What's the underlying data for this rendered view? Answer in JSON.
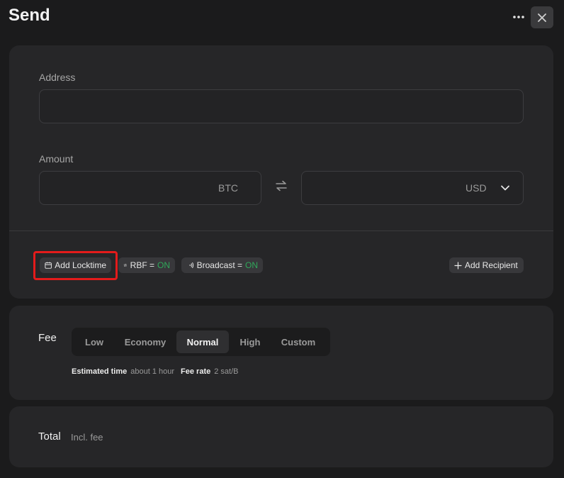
{
  "header": {
    "title": "Send",
    "more_icon": "more-horizontal-icon",
    "close_icon": "close-icon"
  },
  "recipient": {
    "address_label": "Address",
    "address_value": "",
    "amount_label": "Amount",
    "btc_value": "",
    "btc_unit": "BTC",
    "usd_value": "",
    "usd_unit": "USD",
    "swap_icon": "swap-icon"
  },
  "options": {
    "locktime_label": "Add Locktime",
    "rbf_label": "RBF =",
    "rbf_state": "ON",
    "broadcast_label": "Broadcast =",
    "broadcast_state": "ON",
    "add_recipient_label": "Add Recipient",
    "on_color": "#2fa85a"
  },
  "fee": {
    "label": "Fee",
    "options": [
      "Low",
      "Economy",
      "Normal",
      "High",
      "Custom"
    ],
    "selected": "Normal",
    "estimated_time_label": "Estimated time",
    "estimated_time_value": "about 1 hour",
    "fee_rate_label": "Fee rate",
    "fee_rate_value": "2 sat/B"
  },
  "total": {
    "label": "Total",
    "sublabel": "Incl. fee"
  },
  "colors": {
    "background": "#1b1b1c",
    "panel": "#262628",
    "highlight": "#e31b1b"
  }
}
